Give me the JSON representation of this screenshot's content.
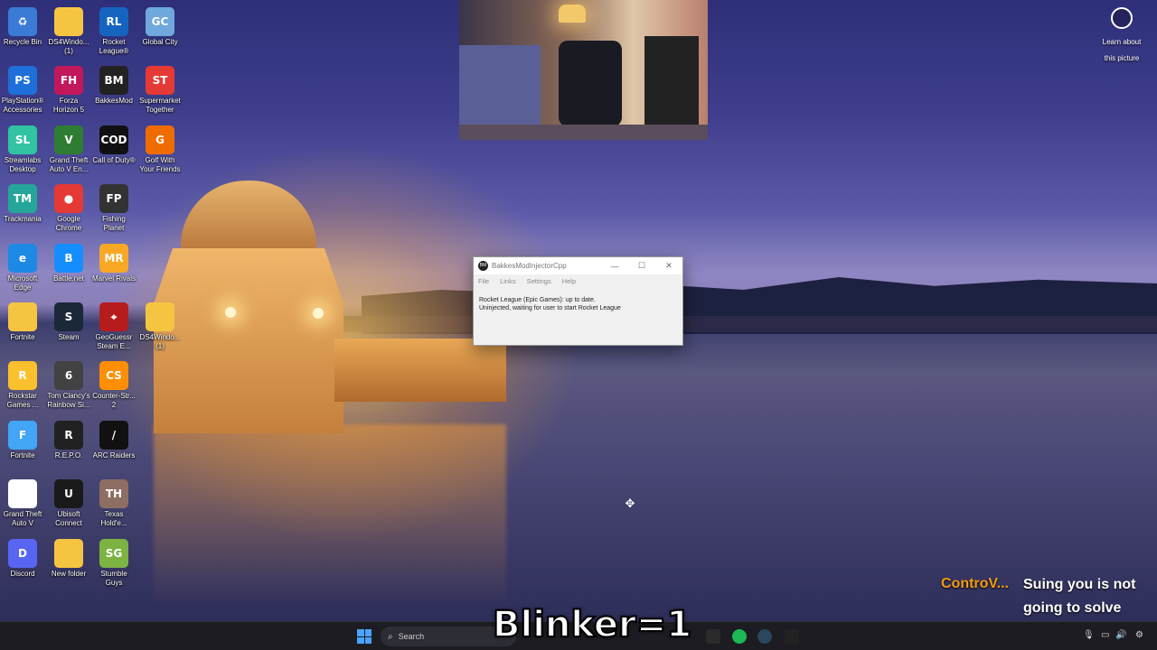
{
  "desktop": {
    "icons": [
      {
        "name": "recycle-bin",
        "label": "Recycle Bin",
        "glyph": "♻",
        "color": "#3a7bd5"
      },
      {
        "name": "ds4windows-1",
        "label": "DS4Windo... (1)",
        "glyph": "",
        "color": "#f5c542"
      },
      {
        "name": "rocket-league",
        "label": "Rocket League®",
        "glyph": "RL",
        "color": "#1565c0"
      },
      {
        "name": "global-city",
        "label": "Global City",
        "glyph": "GC",
        "color": "#6fa8dc"
      },
      {
        "name": "playstation-accessories",
        "label": "PlayStation® Accessories",
        "glyph": "PS",
        "color": "#1e6fd9"
      },
      {
        "name": "forza-horizon-5",
        "label": "Forza Horizon 5",
        "glyph": "FH",
        "color": "#c2185b"
      },
      {
        "name": "bakkesmod",
        "label": "BakkesMod",
        "glyph": "BM",
        "color": "#222222"
      },
      {
        "name": "supermarket-together",
        "label": "Supermarket Together",
        "glyph": "ST",
        "color": "#e53935"
      },
      {
        "name": "streamlabs-desktop",
        "label": "Streamlabs Desktop",
        "glyph": "SL",
        "color": "#31c3a2"
      },
      {
        "name": "gta-v-enhanced",
        "label": "Grand Theft Auto V En...",
        "glyph": "V",
        "color": "#2e7d32"
      },
      {
        "name": "call-of-duty",
        "label": "Call of Duty®",
        "glyph": "COD",
        "color": "#111111"
      },
      {
        "name": "golf-with-your-friends",
        "label": "Golf With Your Friends",
        "glyph": "G",
        "color": "#ef6c00"
      },
      {
        "name": "trackmania",
        "label": "Trackmania",
        "glyph": "TM",
        "color": "#26a69a"
      },
      {
        "name": "google-chrome",
        "label": "Google Chrome",
        "glyph": "●",
        "color": "#e53935"
      },
      {
        "name": "fishing-planet",
        "label": "Fishing Planet",
        "glyph": "FP",
        "color": "#333333"
      },
      {
        "name": "microsoft-edge",
        "label": "Microsoft Edge",
        "glyph": "e",
        "color": "#1e88e5"
      },
      {
        "name": "battle-net",
        "label": "Battle.net",
        "glyph": "B",
        "color": "#148eff"
      },
      {
        "name": "marvel-rivals",
        "label": "Marvel Rivals",
        "glyph": "MR",
        "color": "#f9a825"
      },
      {
        "name": "fortnite-folder",
        "label": "Fortnite",
        "glyph": "",
        "color": "#f5c542"
      },
      {
        "name": "steam",
        "label": "Steam",
        "glyph": "S",
        "color": "#1b2838"
      },
      {
        "name": "geoguessr",
        "label": "GeoGuessr Steam E...",
        "glyph": "⌖",
        "color": "#b71c1c"
      },
      {
        "name": "ds4windows-1b",
        "label": "DS4Windo... (1)",
        "glyph": "",
        "color": "#f5c542"
      },
      {
        "name": "rockstar-games",
        "label": "Rockstar Games ...",
        "glyph": "R",
        "color": "#fbc02d"
      },
      {
        "name": "rainbow-six",
        "label": "Tom Clancy's Rainbow Si...",
        "glyph": "6",
        "color": "#424242"
      },
      {
        "name": "counter-strike-2",
        "label": "Counter-Str... 2",
        "glyph": "CS",
        "color": "#ff8f00"
      },
      {
        "name": "fortnite-app",
        "label": "Fortnite",
        "glyph": "F",
        "color": "#42a5f5"
      },
      {
        "name": "repo",
        "label": "R.E.P.O.",
        "glyph": "R",
        "color": "#212121"
      },
      {
        "name": "arc-raiders",
        "label": "ARC Raiders",
        "glyph": "/",
        "color": "#111111"
      },
      {
        "name": "gta-v-file",
        "label": "Grand Theft Auto V",
        "glyph": "",
        "color": "#ffffff"
      },
      {
        "name": "ubisoft-connect",
        "label": "Ubisoft Connect",
        "glyph": "U",
        "color": "#1a1a1a"
      },
      {
        "name": "texas-holdem",
        "label": "Texas Hold'e...",
        "glyph": "TH",
        "color": "#8d6e63"
      },
      {
        "name": "discord",
        "label": "Discord",
        "glyph": "D",
        "color": "#5865f2"
      },
      {
        "name": "new-folder",
        "label": "New folder",
        "glyph": "",
        "color": "#f5c542"
      },
      {
        "name": "stumble-guys",
        "label": "Stumble Guys",
        "glyph": "SG",
        "color": "#7cb342"
      }
    ],
    "learn_about": "Learn about this picture"
  },
  "window": {
    "app_icon": "BM",
    "title": "BakkesModInjectorCpp",
    "minimize": "—",
    "maximize": "☐",
    "close": "✕",
    "menu": [
      "File",
      "Links",
      "Settings",
      "Help"
    ],
    "status_line1": "Rocket League (Epic Games): up to date.",
    "status_line2": "Uninjected, waiting for user to start Rocket League"
  },
  "overlay": {
    "chat_user": "ControV...",
    "chat_message": "Suing you is not going to solve nothing",
    "blinker": "Blinker=1"
  },
  "taskbar": {
    "search_placeholder": "Search",
    "apps": [
      {
        "name": "epic-games",
        "color": "#2b2b2b"
      },
      {
        "name": "spotify",
        "color": "#1db954"
      },
      {
        "name": "steam",
        "color": "#2a475e"
      },
      {
        "name": "bakkesmod",
        "color": "#222222"
      }
    ]
  }
}
